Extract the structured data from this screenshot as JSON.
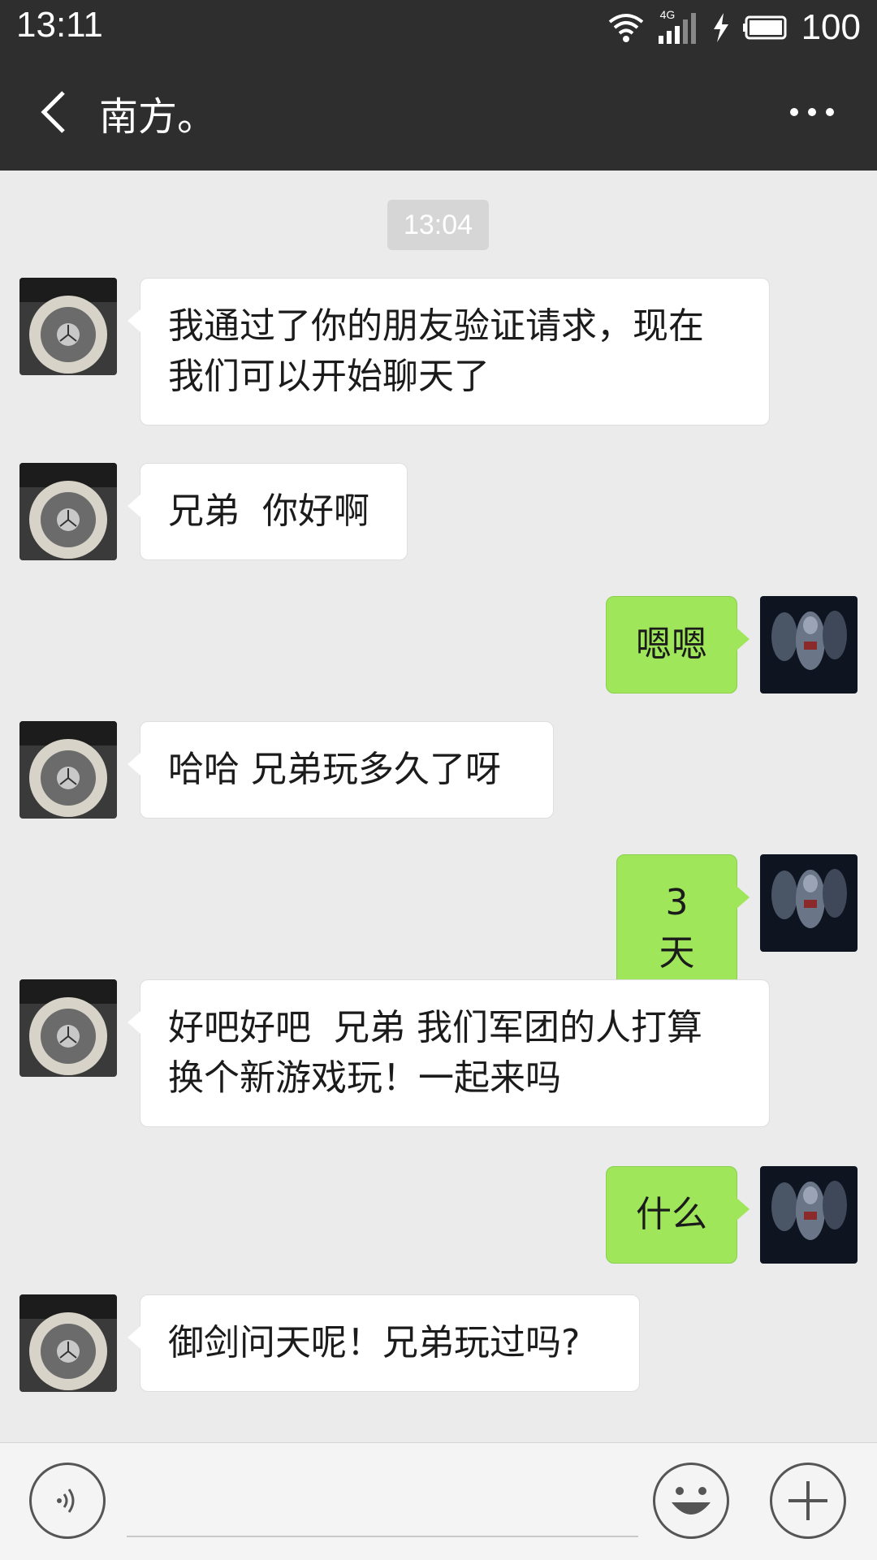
{
  "status_bar": {
    "time": "13:11",
    "network": "4G",
    "battery": "100"
  },
  "header": {
    "title": "南方。",
    "back_icon": "chevron-left-icon",
    "more_icon": "more-dots-icon"
  },
  "chat": {
    "timestamp": "13:04",
    "messages": [
      {
        "side": "left",
        "text": "我通过了你的朋友验证请求，现在\n我们可以开始聊天了"
      },
      {
        "side": "left",
        "text": "兄弟  你好啊"
      },
      {
        "side": "right",
        "text": "嗯嗯"
      },
      {
        "side": "left",
        "text": "哈哈 兄弟玩多久了呀"
      },
      {
        "side": "right",
        "text": "3 天"
      },
      {
        "side": "left",
        "text": "好吧好吧  兄弟 我们军团的人打算\n换个新游戏玩！一起来吗"
      },
      {
        "side": "right",
        "text": "什么"
      },
      {
        "side": "left",
        "text": "御剑问天呢！兄弟玩过吗?"
      }
    ]
  },
  "input_bar": {
    "placeholder": "",
    "voice_icon": "voice-icon",
    "emoji_icon": "emoji-icon",
    "plus_icon": "plus-icon"
  },
  "colors": {
    "header_bg": "#2e2e2e",
    "chat_bg": "#ebebeb",
    "outgoing_bubble": "#9fe65a",
    "incoming_bubble": "#ffffff"
  }
}
